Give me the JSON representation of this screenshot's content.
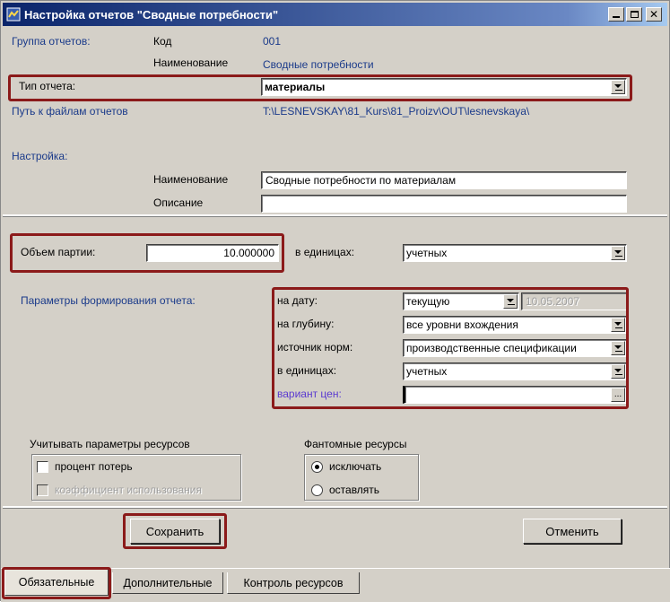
{
  "window": {
    "title": "Настройка отчетов \"Сводные потребности\""
  },
  "group": {
    "label": "Группа отчетов:",
    "code_label": "Код",
    "code_value": "001",
    "name_label": "Наименование",
    "name_value": "Сводные потребности"
  },
  "report_type": {
    "label": "Тип отчета:",
    "value": "материалы"
  },
  "path": {
    "label": "Путь к файлам отчетов",
    "value": "T:\\LESNEVSKAY\\81_Kurs\\81_Proizv\\OUT\\lesnevskaya\\"
  },
  "settings": {
    "label": "Настройка:",
    "name_label": "Наименование",
    "name_value": "Сводные потребности по материалам",
    "desc_label": "Описание",
    "desc_value": ""
  },
  "batch": {
    "label": "Объем партии:",
    "value": "10.000000",
    "units_label": "в единицах:",
    "units_value": "учетных"
  },
  "params": {
    "label": "Параметры формирования отчета:",
    "date_label": "на дату:",
    "date_value": "текущую",
    "date_field": "10.05.2007",
    "depth_label": "на глубину:",
    "depth_value": "все уровни вхождения",
    "source_label": "источник норм:",
    "source_value": "производственные спецификации",
    "units_label": "в единицах:",
    "units_value": "учетных",
    "price_label": "вариант цен:",
    "price_value": ""
  },
  "resources": {
    "label": "Учитывать параметры ресурсов",
    "loss_label": "процент потерь",
    "coef_label": "коэффициент использования"
  },
  "phantom": {
    "label": "Фантомные ресурсы",
    "exclude_label": "исключать",
    "keep_label": "оставлять"
  },
  "buttons": {
    "save": "Сохранить",
    "cancel": "Отменить"
  },
  "tabs": [
    "Обязательные",
    "Дополнительные",
    "Контроль ресурсов"
  ],
  "colors": {
    "highlight": "#8b1a1a",
    "title_start": "#0a246a",
    "label_blue": "#1a3a8a"
  }
}
